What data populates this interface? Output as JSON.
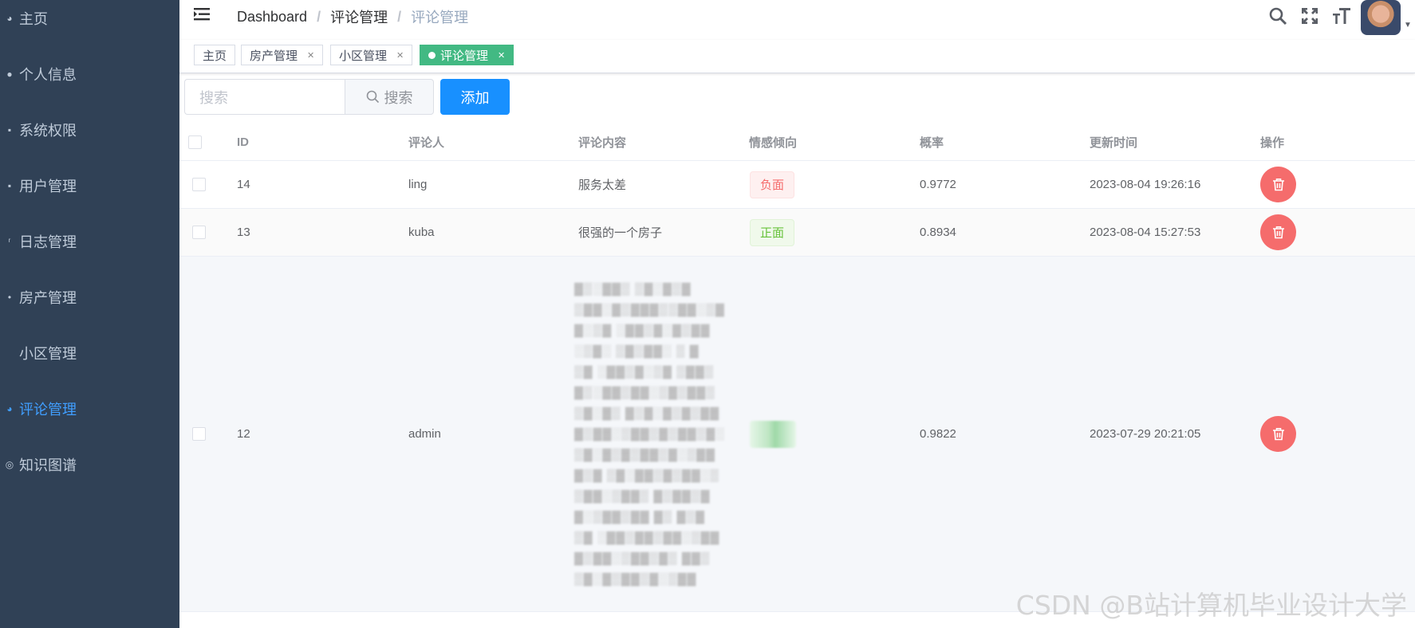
{
  "sidebar": {
    "items": [
      {
        "label": "主页",
        "icon": "home-icon"
      },
      {
        "label": "个人信息",
        "icon": "user-icon"
      },
      {
        "label": "系统权限",
        "icon": "lock-icon"
      },
      {
        "label": "用户管理",
        "icon": "users-icon"
      },
      {
        "label": "日志管理",
        "icon": "edit-icon"
      },
      {
        "label": "房产管理",
        "icon": "arrow-icon"
      },
      {
        "label": "小区管理",
        "icon": "building-icon"
      },
      {
        "label": "评论管理",
        "icon": "comment-icon"
      },
      {
        "label": "知识图谱",
        "icon": "graph-icon"
      }
    ],
    "active_index": 7
  },
  "navbar": {
    "breadcrumb": [
      "Dashboard",
      "评论管理",
      "评论管理"
    ]
  },
  "tags": [
    {
      "label": "主页",
      "closable": false,
      "active": false
    },
    {
      "label": "房产管理",
      "closable": true,
      "active": false
    },
    {
      "label": "小区管理",
      "closable": true,
      "active": false
    },
    {
      "label": "评论管理",
      "closable": true,
      "active": true
    }
  ],
  "toolbar": {
    "search_placeholder": "搜索",
    "search_button": "搜索",
    "add_button": "添加"
  },
  "table": {
    "columns": [
      "ID",
      "评论人",
      "评论内容",
      "情感倾向",
      "概率",
      "更新时间",
      "操作"
    ],
    "rows": [
      {
        "id": "14",
        "author": "ling",
        "content": "服务太差",
        "sentiment": "负面",
        "sentiment_type": "negative",
        "probability": "0.9772",
        "updated": "2023-08-04 19:26:16"
      },
      {
        "id": "13",
        "author": "kuba",
        "content": "很强的一个房子",
        "sentiment": "正面",
        "sentiment_type": "positive",
        "probability": "0.8934",
        "updated": "2023-08-04 15:27:53"
      },
      {
        "id": "12",
        "author": "admin",
        "content": "",
        "sentiment": "",
        "sentiment_type": "blurred",
        "probability": "0.9822",
        "updated": "2023-07-29 20:21:05"
      }
    ]
  },
  "watermark": "CSDN @B站计算机毕业设计大学"
}
